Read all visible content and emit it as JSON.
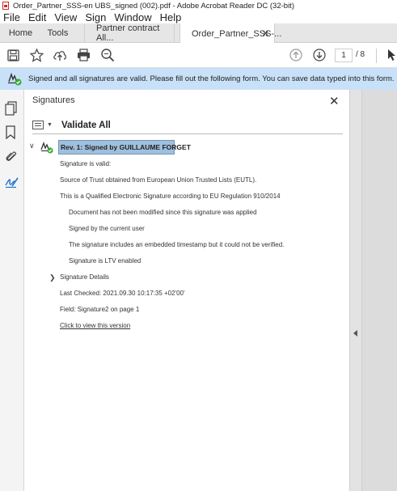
{
  "window": {
    "title": "Order_Partner_SSS-en UBS_signed (002).pdf - Adobe Acrobat Reader DC (32-bit)"
  },
  "menu": [
    "File",
    "Edit",
    "View",
    "Sign",
    "Window",
    "Help"
  ],
  "tabs": {
    "home": "Home",
    "tools": "Tools",
    "doc1": "Partner contract All...",
    "doc2": "Order_Partner_SSS-..."
  },
  "toolbar": {
    "page_current": "1",
    "page_total": "/ 8"
  },
  "signature_bar": {
    "message": "Signed and all signatures are valid.  Please fill out the following form. You can save data typed into this form."
  },
  "signatures_panel": {
    "title": "Signatures",
    "validate_all": "Validate All",
    "revision_label": "Rev. 1: Signed by GUILLAUME FORGET",
    "details": {
      "valid": "Signature is valid:",
      "trust": "Source of Trust obtained from European Union Trusted Lists (EUTL).",
      "qualified": "This is a Qualified Electronic Signature according to EU Regulation 910/2014",
      "not_modified": "Document has not been modified since this signature was applied",
      "signed_by_user": "Signed by the current user",
      "timestamp": "The signature includes an embedded timestamp but it could not be verified.",
      "ltv": "Signature is LTV enabled",
      "sig_details": "Signature Details",
      "last_checked": "Last Checked: 2021.09.30 10:17:35 +02'00'",
      "field": "Field: Signature2 on page 1",
      "view_version": "Click to view this version"
    }
  },
  "colors": {
    "signature_bar_bg": "#c8e1f8",
    "selection_bg": "#9fc0dd",
    "valid_green": "#3aa935"
  }
}
